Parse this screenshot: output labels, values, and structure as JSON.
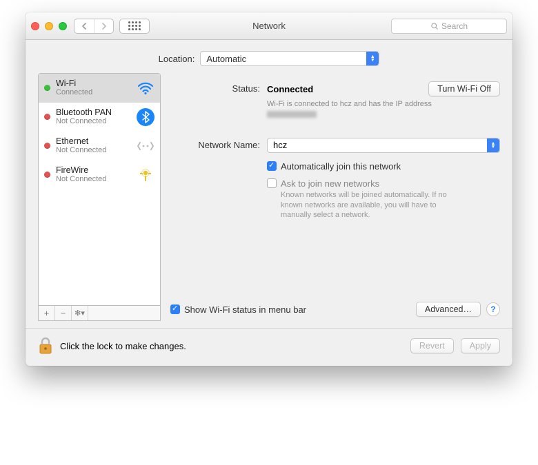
{
  "window": {
    "title": "Network",
    "search_placeholder": "Search"
  },
  "location": {
    "label": "Location:",
    "value": "Automatic"
  },
  "sidebar": {
    "items": [
      {
        "name": "Wi-Fi",
        "sub": "Connected"
      },
      {
        "name": "Bluetooth PAN",
        "sub": "Not Connected"
      },
      {
        "name": "Ethernet",
        "sub": "Not Connected"
      },
      {
        "name": "FireWire",
        "sub": "Not Connected"
      }
    ]
  },
  "main": {
    "status_label": "Status:",
    "status_value": "Connected",
    "wifi_toggle": "Turn Wi-Fi Off",
    "status_desc": "Wi-Fi is connected to hcz and has the IP address",
    "network_name_label": "Network Name:",
    "network_name_value": "hcz",
    "auto_join": "Automatically join this network",
    "ask_join": "Ask to join new networks",
    "ask_help": "Known networks will be joined automatically. If no known networks are available, you will have to manually select a network.",
    "show_status": "Show Wi-Fi status in menu bar",
    "advanced": "Advanced…"
  },
  "footer": {
    "lock_text": "Click the lock to make changes.",
    "revert": "Revert",
    "apply": "Apply"
  }
}
